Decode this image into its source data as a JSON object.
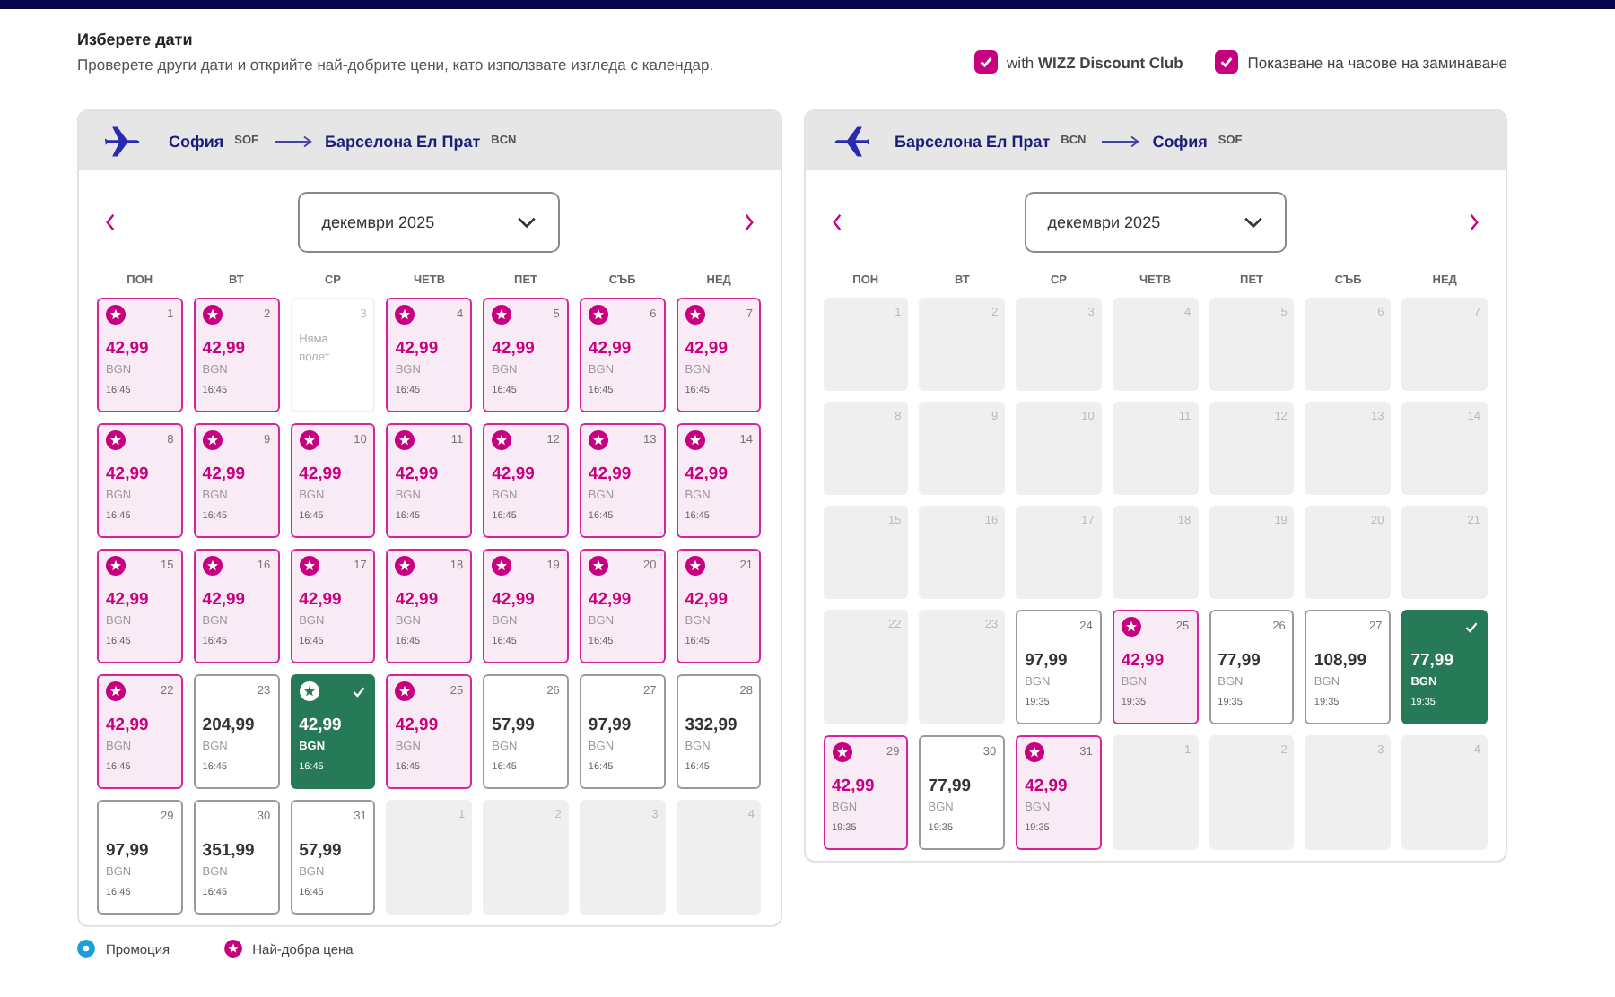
{
  "header": {
    "title": "Изберете дати",
    "subtitle": "Проверете други дати и открийте най-добрите цени, като използвате изгледа с календар."
  },
  "options": [
    {
      "label": "with **WIZZ Discount Club**",
      "checked": true
    },
    {
      "label": "Показване на часове на заминаване",
      "checked": true
    }
  ],
  "calendars": [
    {
      "from": {
        "city": "София",
        "code": "SOF"
      },
      "to": {
        "city": "Барселона Ел Прат",
        "code": "BCN"
      },
      "month": "декември 2025",
      "weekdays": [
        "ПОН",
        "ВТ",
        "СР",
        "ЧЕТВ",
        "ПЕТ",
        "СЪБ",
        "НЕД"
      ],
      "days": [
        {
          "day": "1",
          "kind": "price",
          "best": true,
          "selected": false,
          "price": "42,99",
          "currency": "BGN",
          "time": "16:45"
        },
        {
          "day": "2",
          "kind": "price",
          "best": true,
          "selected": false,
          "price": "42,99",
          "currency": "BGN",
          "time": "16:45"
        },
        {
          "day": "3",
          "kind": "no_flight",
          "text": "Няма полет"
        },
        {
          "day": "4",
          "kind": "price",
          "best": true,
          "selected": false,
          "price": "42,99",
          "currency": "BGN",
          "time": "16:45"
        },
        {
          "day": "5",
          "kind": "price",
          "best": true,
          "selected": false,
          "price": "42,99",
          "currency": "BGN",
          "time": "16:45"
        },
        {
          "day": "6",
          "kind": "price",
          "best": true,
          "selected": false,
          "price": "42,99",
          "currency": "BGN",
          "time": "16:45"
        },
        {
          "day": "7",
          "kind": "price",
          "best": true,
          "selected": false,
          "price": "42,99",
          "currency": "BGN",
          "time": "16:45"
        },
        {
          "day": "8",
          "kind": "price",
          "best": true,
          "selected": false,
          "price": "42,99",
          "currency": "BGN",
          "time": "16:45"
        },
        {
          "day": "9",
          "kind": "price",
          "best": true,
          "selected": false,
          "price": "42,99",
          "currency": "BGN",
          "time": "16:45"
        },
        {
          "day": "10",
          "kind": "price",
          "best": true,
          "selected": false,
          "price": "42,99",
          "currency": "BGN",
          "time": "16:45"
        },
        {
          "day": "11",
          "kind": "price",
          "best": true,
          "selected": false,
          "price": "42,99",
          "currency": "BGN",
          "time": "16:45"
        },
        {
          "day": "12",
          "kind": "price",
          "best": true,
          "selected": false,
          "price": "42,99",
          "currency": "BGN",
          "time": "16:45"
        },
        {
          "day": "13",
          "kind": "price",
          "best": true,
          "selected": false,
          "price": "42,99",
          "currency": "BGN",
          "time": "16:45"
        },
        {
          "day": "14",
          "kind": "price",
          "best": true,
          "selected": false,
          "price": "42,99",
          "currency": "BGN",
          "time": "16:45"
        },
        {
          "day": "15",
          "kind": "price",
          "best": true,
          "selected": false,
          "price": "42,99",
          "currency": "BGN",
          "time": "16:45"
        },
        {
          "day": "16",
          "kind": "price",
          "best": true,
          "selected": false,
          "price": "42,99",
          "currency": "BGN",
          "time": "16:45"
        },
        {
          "day": "17",
          "kind": "price",
          "best": true,
          "selected": false,
          "price": "42,99",
          "currency": "BGN",
          "time": "16:45"
        },
        {
          "day": "18",
          "kind": "price",
          "best": true,
          "selected": false,
          "price": "42,99",
          "currency": "BGN",
          "time": "16:45"
        },
        {
          "day": "19",
          "kind": "price",
          "best": true,
          "selected": false,
          "price": "42,99",
          "currency": "BGN",
          "time": "16:45"
        },
        {
          "day": "20",
          "kind": "price",
          "best": true,
          "selected": false,
          "price": "42,99",
          "currency": "BGN",
          "time": "16:45"
        },
        {
          "day": "21",
          "kind": "price",
          "best": true,
          "selected": false,
          "price": "42,99",
          "currency": "BGN",
          "time": "16:45"
        },
        {
          "day": "22",
          "kind": "price",
          "best": true,
          "selected": false,
          "price": "42,99",
          "currency": "BGN",
          "time": "16:45"
        },
        {
          "day": "23",
          "kind": "price",
          "best": false,
          "selected": false,
          "price": "204,99",
          "currency": "BGN",
          "time": "16:45"
        },
        {
          "kind": "price",
          "best": true,
          "selected": true,
          "price": "42,99",
          "currency": "BGN",
          "time": "16:45"
        },
        {
          "day": "25",
          "kind": "price",
          "best": true,
          "selected": false,
          "price": "42,99",
          "currency": "BGN",
          "time": "16:45"
        },
        {
          "day": "26",
          "kind": "price",
          "best": false,
          "selected": false,
          "price": "57,99",
          "currency": "BGN",
          "time": "16:45"
        },
        {
          "day": "27",
          "kind": "price",
          "best": false,
          "selected": false,
          "price": "97,99",
          "currency": "BGN",
          "time": "16:45"
        },
        {
          "day": "28",
          "kind": "price",
          "best": false,
          "selected": false,
          "price": "332,99",
          "currency": "BGN",
          "time": "16:45"
        },
        {
          "day": "29",
          "kind": "price",
          "best": false,
          "selected": false,
          "price": "97,99",
          "currency": "BGN",
          "time": "16:45"
        },
        {
          "day": "30",
          "kind": "price",
          "best": false,
          "selected": false,
          "price": "351,99",
          "currency": "BGN",
          "time": "16:45"
        },
        {
          "day": "31",
          "kind": "price",
          "best": false,
          "selected": false,
          "price": "57,99",
          "currency": "BGN",
          "time": "16:45"
        },
        {
          "day": "1",
          "kind": "unavailable"
        },
        {
          "day": "2",
          "kind": "unavailable"
        },
        {
          "day": "3",
          "kind": "unavailable"
        },
        {
          "day": "4",
          "kind": "unavailable"
        }
      ]
    },
    {
      "from": {
        "city": "Барселона Ел Прат",
        "code": "BCN"
      },
      "to": {
        "city": "София",
        "code": "SOF"
      },
      "month": "декември 2025",
      "weekdays": [
        "ПОН",
        "ВТ",
        "СР",
        "ЧЕТВ",
        "ПЕТ",
        "СЪБ",
        "НЕД"
      ],
      "days": [
        {
          "day": "1",
          "kind": "unavailable"
        },
        {
          "day": "2",
          "kind": "unavailable"
        },
        {
          "day": "3",
          "kind": "unavailable"
        },
        {
          "day": "4",
          "kind": "unavailable"
        },
        {
          "day": "5",
          "kind": "unavailable"
        },
        {
          "day": "6",
          "kind": "unavailable"
        },
        {
          "day": "7",
          "kind": "unavailable"
        },
        {
          "day": "8",
          "kind": "unavailable"
        },
        {
          "day": "9",
          "kind": "unavailable"
        },
        {
          "day": "10",
          "kind": "unavailable"
        },
        {
          "day": "11",
          "kind": "unavailable"
        },
        {
          "day": "12",
          "kind": "unavailable"
        },
        {
          "day": "13",
          "kind": "unavailable"
        },
        {
          "day": "14",
          "kind": "unavailable"
        },
        {
          "day": "15",
          "kind": "unavailable"
        },
        {
          "day": "16",
          "kind": "unavailable"
        },
        {
          "day": "17",
          "kind": "unavailable"
        },
        {
          "day": "18",
          "kind": "unavailable"
        },
        {
          "day": "19",
          "kind": "unavailable"
        },
        {
          "day": "20",
          "kind": "unavailable"
        },
        {
          "day": "21",
          "kind": "unavailable"
        },
        {
          "day": "22",
          "kind": "unavailable"
        },
        {
          "day": "23",
          "kind": "unavailable"
        },
        {
          "day": "24",
          "kind": "price",
          "best": false,
          "selected": false,
          "price": "97,99",
          "currency": "BGN",
          "time": "19:35"
        },
        {
          "day": "25",
          "kind": "price",
          "best": true,
          "selected": false,
          "price": "42,99",
          "currency": "BGN",
          "time": "19:35"
        },
        {
          "day": "26",
          "kind": "price",
          "best": false,
          "selected": false,
          "price": "77,99",
          "currency": "BGN",
          "time": "19:35"
        },
        {
          "day": "27",
          "kind": "price",
          "best": false,
          "selected": false,
          "price": "108,99",
          "currency": "BGN",
          "time": "19:35"
        },
        {
          "kind": "price",
          "best": false,
          "selected": true,
          "price": "77,99",
          "currency": "BGN",
          "time": "19:35"
        },
        {
          "day": "29",
          "kind": "price",
          "best": true,
          "selected": false,
          "price": "42,99",
          "currency": "BGN",
          "time": "19:35"
        },
        {
          "day": "30",
          "kind": "price",
          "best": false,
          "selected": false,
          "price": "77,99",
          "currency": "BGN",
          "time": "19:35"
        },
        {
          "day": "31",
          "kind": "price",
          "best": true,
          "selected": false,
          "price": "42,99",
          "currency": "BGN",
          "time": "19:35"
        },
        {
          "day": "1",
          "kind": "unavailable"
        },
        {
          "day": "2",
          "kind": "unavailable"
        },
        {
          "day": "3",
          "kind": "unavailable"
        },
        {
          "day": "4",
          "kind": "unavailable"
        }
      ]
    }
  ],
  "legend": [
    {
      "kind": "promo",
      "label": "Промоция"
    },
    {
      "kind": "best",
      "label": "Най-добра цена"
    }
  ]
}
